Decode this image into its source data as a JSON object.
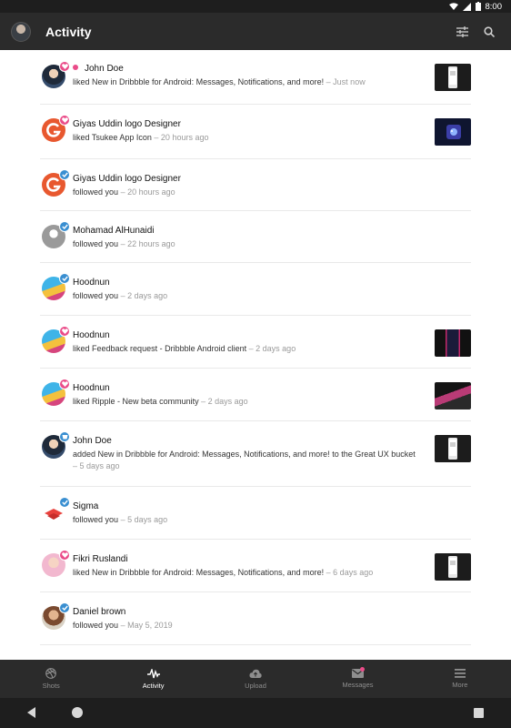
{
  "status_bar": {
    "time": "8:00",
    "network": "LTE"
  },
  "app_bar": {
    "title": "Activity",
    "icons": [
      "filter-icon",
      "search-icon"
    ]
  },
  "activity": [
    {
      "name": "John Doe",
      "action": "liked",
      "subject": "New in Dribbble for Android: Messages, Notifications, and more!",
      "suffix": "",
      "time": "– Just now",
      "kind": "like",
      "unread": true,
      "thumb": true
    },
    {
      "name": "Giyas Uddin logo Designer",
      "action": "liked",
      "subject": "Tsukee App Icon",
      "suffix": "",
      "time": "– 20 hours ago",
      "kind": "like",
      "unread": false,
      "thumb": true
    },
    {
      "name": "Giyas Uddin logo Designer",
      "action": "followed you",
      "subject": "",
      "suffix": "",
      "time": "– 20 hours ago",
      "kind": "follow",
      "unread": false,
      "thumb": false
    },
    {
      "name": "Mohamad AlHunaidi",
      "action": "followed you",
      "subject": "",
      "suffix": "",
      "time": "– 22 hours ago",
      "kind": "follow",
      "unread": false,
      "thumb": false
    },
    {
      "name": "Hoodnun",
      "action": "followed you",
      "subject": "",
      "suffix": "",
      "time": "– 2 days ago",
      "kind": "follow",
      "unread": false,
      "thumb": false
    },
    {
      "name": "Hoodnun",
      "action": "liked",
      "subject": "Feedback request - Dribbble Android client",
      "suffix": "",
      "time": "– 2 days ago",
      "kind": "like",
      "unread": false,
      "thumb": true
    },
    {
      "name": "Hoodnun",
      "action": "liked",
      "subject": "Ripple - New beta community",
      "suffix": "",
      "time": "– 2 days ago",
      "kind": "like",
      "unread": false,
      "thumb": true
    },
    {
      "name": "John Doe",
      "action": "added",
      "subject": "New in Dribbble for Android: Messages, Notifications, and more!",
      "suffix": "to the Great UX bucket",
      "time": "– 5 days ago",
      "kind": "bucket",
      "unread": false,
      "thumb": true
    },
    {
      "name": "Sigma",
      "action": "followed you",
      "subject": "",
      "suffix": "",
      "time": "– 5 days ago",
      "kind": "follow",
      "unread": false,
      "thumb": false
    },
    {
      "name": "Fikri Ruslandi",
      "action": "liked",
      "subject": "New in Dribbble for Android: Messages, Notifications, and more!",
      "suffix": "",
      "time": "– 6 days ago",
      "kind": "like",
      "unread": false,
      "thumb": true
    },
    {
      "name": "Daniel brown",
      "action": "followed you",
      "subject": "",
      "suffix": "",
      "time": "– May 5, 2019",
      "kind": "follow",
      "unread": false,
      "thumb": false
    }
  ],
  "bottom_nav": [
    {
      "label": "Shots",
      "icon": "dribbble-icon",
      "active": false
    },
    {
      "label": "Activity",
      "icon": "activity-icon",
      "active": true
    },
    {
      "label": "Upload",
      "icon": "upload-cloud-icon",
      "active": false
    },
    {
      "label": "Messages",
      "icon": "mail-icon",
      "active": false,
      "dot": true
    },
    {
      "label": "More",
      "icon": "menu-icon",
      "active": false
    }
  ],
  "colors": {
    "accent": "#ea4c89",
    "follow_badge": "#3a8fd1",
    "bar": "#2b2b2b"
  }
}
